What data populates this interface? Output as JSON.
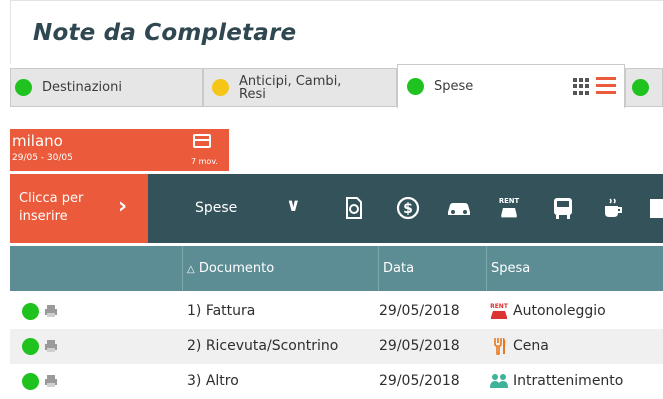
{
  "page": {
    "title": "Note da Completare"
  },
  "tabs": [
    {
      "label": "Destinazioni",
      "dot_color": "#1fc21f",
      "active": false
    },
    {
      "label": "Anticipi, Cambi, Resi",
      "dot_color": "#f5c518",
      "active": false
    },
    {
      "label": "Spese",
      "dot_color": "#1fc21f",
      "active": true
    },
    {
      "label": "",
      "dot_color": "#1fc21f",
      "active": false
    }
  ],
  "city": {
    "name": "milano",
    "dates": "29/05 - 30/05",
    "count_label": "7 mov.",
    "icon": "ticket-icon"
  },
  "toolbar": {
    "insert_label": "Clicca per inserire",
    "select_value": "Spese",
    "icons": [
      "receipt-icon",
      "money-icon",
      "car-icon",
      "rent-icon",
      "bus-icon",
      "coffee-icon",
      "more-icon"
    ]
  },
  "table": {
    "columns": [
      "",
      "Documento",
      "Data",
      "Spesa"
    ],
    "sort_indicator": "△",
    "rows": [
      {
        "documento": "1) Fattura",
        "data": "29/05/2018",
        "spesa": "Autonoleggio",
        "icon": "rent-car-icon"
      },
      {
        "documento": "2) Ricevuta/Scontrino",
        "data": "29/05/2018",
        "spesa": "Cena",
        "icon": "fork-knife-icon"
      },
      {
        "documento": "3) Altro",
        "data": "29/05/2018",
        "spesa": "Intrattenimento",
        "icon": "people-icon"
      }
    ]
  },
  "colors": {
    "accent": "#ea5a3b",
    "toolbar": "#34525a",
    "header": "#5c8d94",
    "status_green": "#1fc21f",
    "status_yellow": "#f5c518"
  }
}
